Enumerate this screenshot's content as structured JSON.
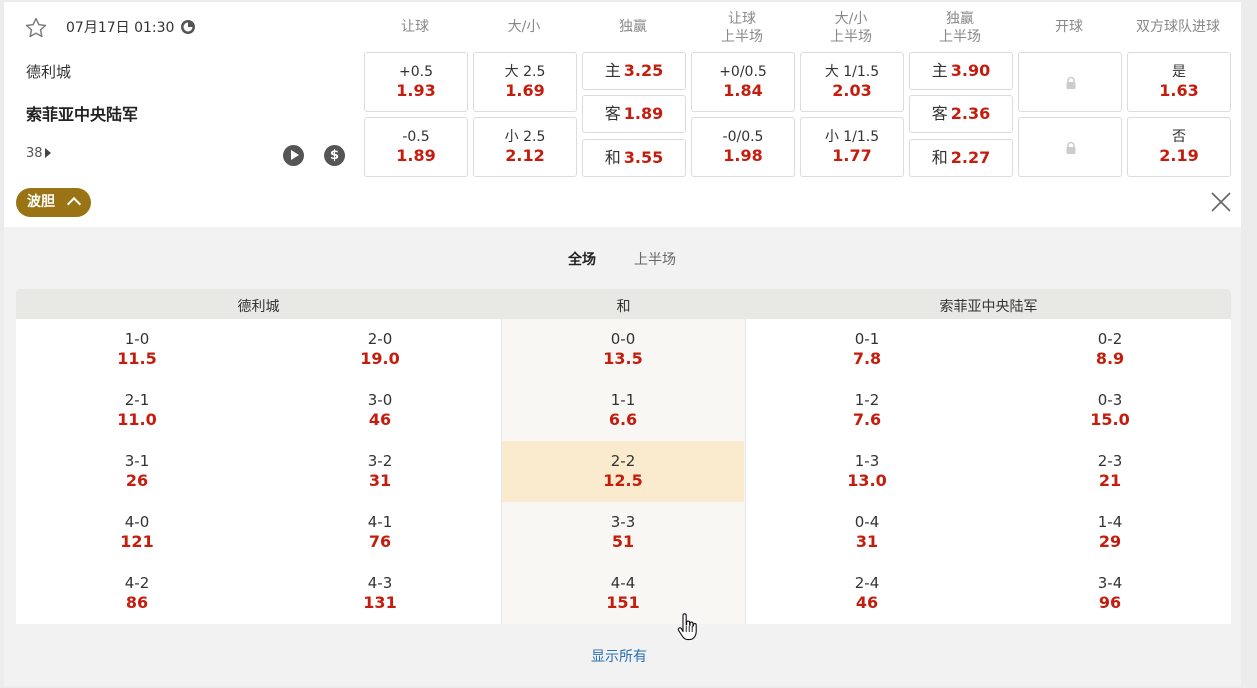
{
  "match": {
    "kickoff": "07月17日 01:30",
    "home_team": "德利城",
    "away_team": "索菲亚中央陆军",
    "more_count": "38"
  },
  "columns": {
    "handicap": "让球",
    "total": "大/小",
    "moneyline": "独赢",
    "handicap_1h_a": "让球",
    "handicap_1h_b": "上半场",
    "total_1h_a": "大/小",
    "total_1h_b": "上半场",
    "moneyline_1h_a": "独赢",
    "moneyline_1h_b": "上半场",
    "first_goal": "开球",
    "btts": "双方球队进球"
  },
  "odds": {
    "handicap": [
      {
        "label": "+0.5",
        "odds": "1.93"
      },
      {
        "label": "-0.5",
        "odds": "1.89"
      }
    ],
    "total": [
      {
        "label": "大 2.5",
        "odds": "1.69"
      },
      {
        "label": "小 2.5",
        "odds": "2.12"
      }
    ],
    "moneyline": [
      {
        "label": "主",
        "odds": "3.25"
      },
      {
        "label": "客",
        "odds": "1.89"
      },
      {
        "label": "和",
        "odds": "3.55"
      }
    ],
    "handicap_1h": [
      {
        "label": "+0/0.5",
        "odds": "1.84"
      },
      {
        "label": "-0/0.5",
        "odds": "1.98"
      }
    ],
    "total_1h": [
      {
        "label": "大 1/1.5",
        "odds": "2.03"
      },
      {
        "label": "小 1/1.5",
        "odds": "1.77"
      }
    ],
    "moneyline_1h": [
      {
        "label": "主",
        "odds": "3.90"
      },
      {
        "label": "客",
        "odds": "2.36"
      },
      {
        "label": "和",
        "odds": "2.27"
      }
    ],
    "btts": [
      {
        "label": "是",
        "odds": "1.63"
      },
      {
        "label": "否",
        "odds": "2.19"
      }
    ]
  },
  "correct_score": {
    "toggle_label": "波胆",
    "tabs": [
      {
        "label": "全场"
      },
      {
        "label": "上半场"
      }
    ],
    "headers": {
      "home": "德利城",
      "draw": "和",
      "away": "索菲亚中央陆军"
    },
    "home_col1": [
      {
        "score": "1-0",
        "odds": "11.5"
      },
      {
        "score": "2-1",
        "odds": "11.0"
      },
      {
        "score": "3-1",
        "odds": "26"
      },
      {
        "score": "4-0",
        "odds": "121"
      },
      {
        "score": "4-2",
        "odds": "86"
      }
    ],
    "home_col2": [
      {
        "score": "2-0",
        "odds": "19.0"
      },
      {
        "score": "3-0",
        "odds": "46"
      },
      {
        "score": "3-2",
        "odds": "31"
      },
      {
        "score": "4-1",
        "odds": "76"
      },
      {
        "score": "4-3",
        "odds": "131"
      }
    ],
    "draw_col": [
      {
        "score": "0-0",
        "odds": "13.5"
      },
      {
        "score": "1-1",
        "odds": "6.6"
      },
      {
        "score": "2-2",
        "odds": "12.5"
      },
      {
        "score": "3-3",
        "odds": "51"
      },
      {
        "score": "4-4",
        "odds": "151"
      }
    ],
    "away_col1": [
      {
        "score": "0-1",
        "odds": "7.8"
      },
      {
        "score": "1-2",
        "odds": "7.6"
      },
      {
        "score": "1-3",
        "odds": "13.0"
      },
      {
        "score": "0-4",
        "odds": "31"
      },
      {
        "score": "2-4",
        "odds": "46"
      }
    ],
    "away_col2": [
      {
        "score": "0-2",
        "odds": "8.9"
      },
      {
        "score": "0-3",
        "odds": "15.0"
      },
      {
        "score": "2-3",
        "odds": "21"
      },
      {
        "score": "1-4",
        "odds": "29"
      },
      {
        "score": "3-4",
        "odds": "96"
      }
    ],
    "show_all": "显示所有"
  },
  "colors": {
    "odds_red": "#c41d0e",
    "accent_gold": "#9a7414",
    "highlight": "#faebcf"
  }
}
